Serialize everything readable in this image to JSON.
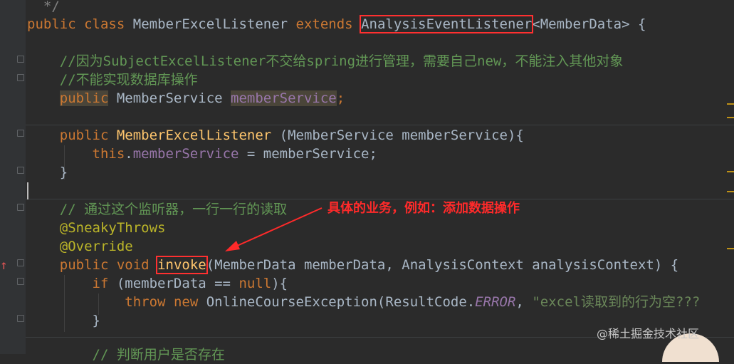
{
  "editor": {
    "lines": {
      "l0": "*/",
      "l1_kw1": "public",
      "l1_kw2": "class",
      "l1_name": "MemberExcelListener",
      "l1_kw3": "extends",
      "l1_base": "AnalysisEventListener",
      "l1_rest": "<MemberData> {",
      "l2": "//因为SubjectExcelListener不交给spring进行管理，需要自己new，不能注入其他对象",
      "l3": "//不能实现数据库操作",
      "l4_kw": "public",
      "l4_type": "MemberService",
      "l4_field": "memberService",
      "l4_end": ";",
      "l5_kw": "public",
      "l5_fn": "MemberExcelListener",
      "l5_rest": "(MemberService memberService){",
      "l6_kw": "this",
      "l6_dot": ".",
      "l6_field": "memberService",
      "l6_rest": " = memberService;",
      "l7": "}",
      "l8": "// 通过这个监听器，一行一行的读取",
      "l9": "@SneakyThrows",
      "l10": "@Override",
      "l11_kw1": "public",
      "l11_kw2": "void",
      "l11_fn": "invoke",
      "l11_rest": "(MemberData memberData, AnalysisContext analysisContext) {",
      "l12_kw": "if",
      "l12_a": " (memberData == ",
      "l12_null": "null",
      "l12_b": "){",
      "l13_kw1": "throw",
      "l13_kw2": "new",
      "l13_a": "OnlineCourseException(ResultCode.",
      "l13_err": "ERROR",
      "l13_b": ", ",
      "l13_str": "\"excel读取到的行为空???",
      "l14": "}",
      "l15": "// 判断用户是否存在"
    }
  },
  "annotation": {
    "note": "具体的业务，例如：添加数据操作"
  },
  "watermark": "@稀土掘金技术社区",
  "colors": {
    "background": "#2b2b2b",
    "keyword": "#cc7832",
    "comment": "#629755",
    "field": "#9876aa",
    "annotation_red": "#ff2a2a"
  }
}
